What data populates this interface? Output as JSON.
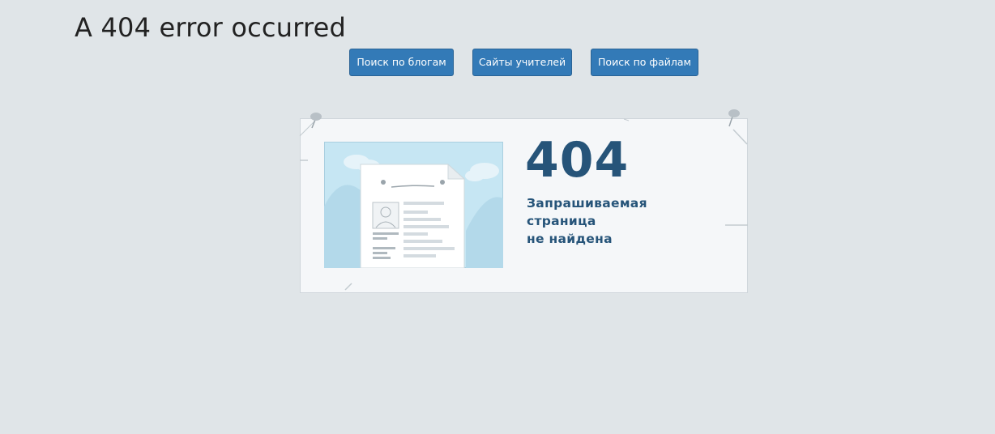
{
  "page": {
    "title": "A 404 error occurred"
  },
  "nav": {
    "buttons": [
      {
        "label": "Поиск по блогам"
      },
      {
        "label": "Сайты учителей"
      },
      {
        "label": "Поиск по файлам"
      }
    ]
  },
  "card": {
    "error_code": "404",
    "message_lines": [
      "Запрашиваемая",
      "страница",
      "не найдена"
    ],
    "illustration_icon": "missing-document-icon"
  },
  "colors": {
    "page_background": "#e0e5e8",
    "button_background": "#337ab7",
    "accent_text": "#265479",
    "card_background": "#f5f7f9",
    "illustration_sky": "#c6e6f3"
  }
}
